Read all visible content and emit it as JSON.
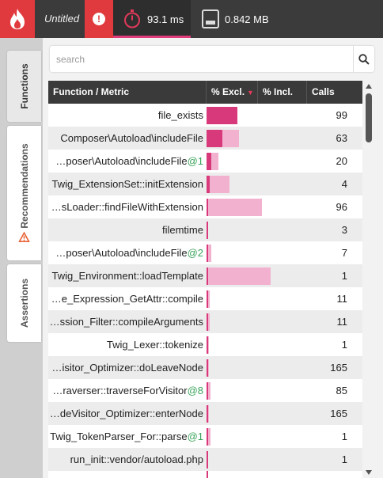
{
  "topbar": {
    "title": "Untitled",
    "time_value": "93.1 ms",
    "memory_value": "0.842 MB",
    "icons": [
      "flame-logo-icon",
      "alert-icon",
      "stopwatch-icon",
      "memory-icon"
    ]
  },
  "tabs": [
    {
      "label": "Functions",
      "active": true
    },
    {
      "label": "Recommendations",
      "active": false,
      "icon": "warning-icon"
    },
    {
      "label": "Assertions",
      "active": false
    }
  ],
  "search": {
    "placeholder": "search"
  },
  "table": {
    "headers": {
      "function": "Function / Metric",
      "excl": "% Excl.",
      "incl": "% Incl.",
      "calls": "Calls"
    },
    "sort_indicator": "▼",
    "rows": [
      {
        "name": "file_exists",
        "suffix": "",
        "excl": 30.5,
        "incl": 30.5,
        "calls": "99"
      },
      {
        "name": "Composer\\Autoload\\includeFile",
        "suffix": "",
        "excl": 16,
        "incl": 32,
        "calls": "63"
      },
      {
        "name": "…poser\\Autoload\\includeFile",
        "suffix": "@1",
        "excl": 5,
        "incl": 12,
        "calls": "20"
      },
      {
        "name": "Twig_ExtensionSet::initExtension",
        "suffix": "",
        "excl": 3,
        "incl": 23,
        "calls": "4"
      },
      {
        "name": "…sLoader::findFileWithExtension",
        "suffix": "",
        "excl": 1.5,
        "incl": 55,
        "calls": "96"
      },
      {
        "name": "filemtime",
        "suffix": "",
        "excl": 1,
        "incl": 1,
        "calls": "3"
      },
      {
        "name": "…poser\\Autoload\\includeFile",
        "suffix": "@2",
        "excl": 1,
        "incl": 5,
        "calls": "7"
      },
      {
        "name": "Twig_Environment::loadTemplate",
        "suffix": "",
        "excl": 1,
        "incl": 64,
        "calls": "1"
      },
      {
        "name": "…e_Expression_GetAttr::compile",
        "suffix": "",
        "excl": 1,
        "incl": 3,
        "calls": "11"
      },
      {
        "name": "…ssion_Filter::compileArguments",
        "suffix": "",
        "excl": 1,
        "incl": 3,
        "calls": "11"
      },
      {
        "name": "Twig_Lexer::tokenize",
        "suffix": "",
        "excl": 1,
        "incl": 2,
        "calls": "1"
      },
      {
        "name": "…isitor_Optimizer::doLeaveNode",
        "suffix": "",
        "excl": 1,
        "incl": 2,
        "calls": "165"
      },
      {
        "name": "…raverser::traverseForVisitor",
        "suffix": "@8",
        "excl": 1,
        "incl": 4,
        "calls": "85"
      },
      {
        "name": "…deVisitor_Optimizer::enterNode",
        "suffix": "",
        "excl": 1,
        "incl": 2,
        "calls": "165"
      },
      {
        "name": "Twig_TokenParser_For::parse",
        "suffix": "@1",
        "excl": 1,
        "incl": 4,
        "calls": "1"
      },
      {
        "name": "run_init::vendor/autoload.php",
        "suffix": "",
        "excl": 1,
        "incl": 1,
        "calls": "1"
      }
    ]
  },
  "colors": {
    "brand": "#e03a3e",
    "excl_bar": "#d8397a",
    "incl_bar": "#f2b1cf",
    "header_bg": "#3a3a3a",
    "suffix": "#3aa35a"
  }
}
